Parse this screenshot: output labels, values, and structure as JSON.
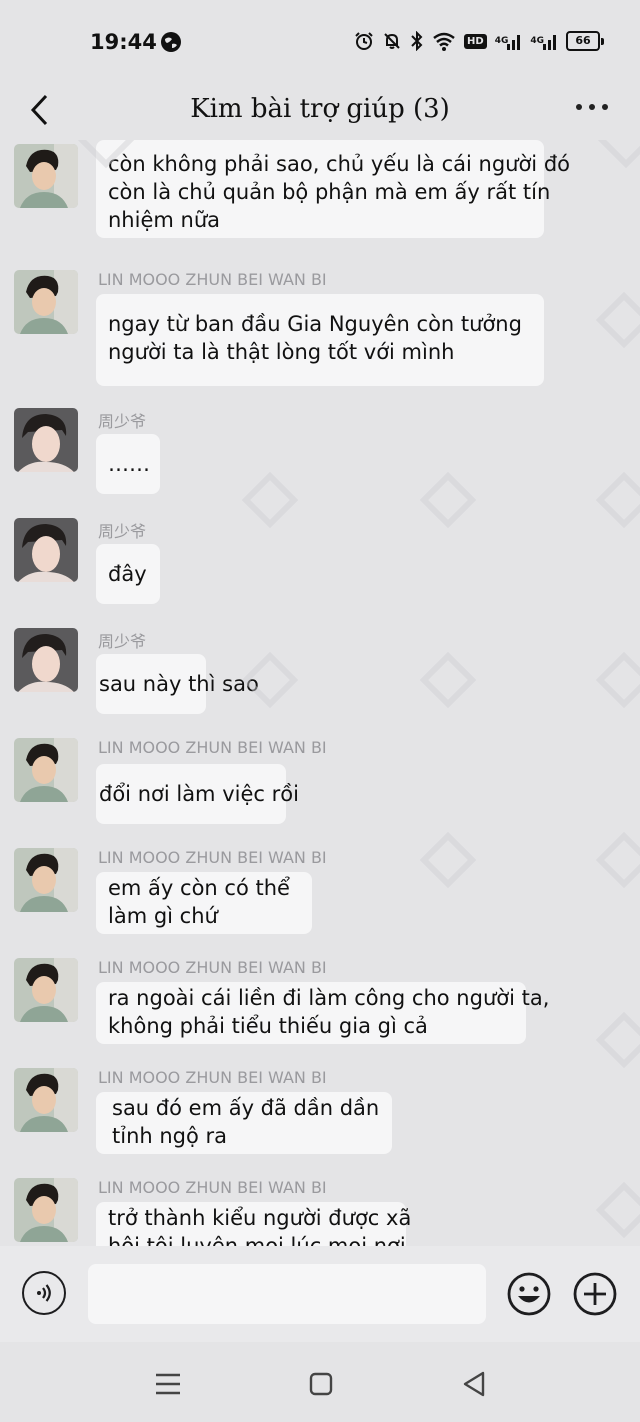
{
  "status_bar": {
    "time": "19:44",
    "network_1": "4G",
    "network_2": "4G",
    "hd_label": "HD",
    "battery": "66",
    "icons": [
      "globe-icon",
      "alarm-icon",
      "mute-icon",
      "bluetooth-icon",
      "wifi-icon",
      "hd-icon",
      "signal-icon",
      "battery-icon"
    ]
  },
  "header": {
    "title": "Kim bài trợ giúp (3)",
    "back_icon": "chevron-left-icon",
    "more_icon": "more-icon"
  },
  "messages": [
    {
      "sender": "",
      "avatar": "avatar-lin",
      "lines": [
        "còn không phải sao, chủ yếu là cái người đó",
        "còn là chủ quản bộ phận mà em ấy rất tín",
        "nhiệm nữa"
      ]
    },
    {
      "sender": "LIN MOOO ZHUN BEI WAN BI",
      "avatar": "avatar-lin",
      "lines": [
        "ngay từ ban đầu Gia Nguyên còn tưởng",
        "người ta là thật lòng tốt với mình"
      ]
    },
    {
      "sender": "周少爷",
      "avatar": "avatar-zhou",
      "lines": [
        "……"
      ]
    },
    {
      "sender": "周少爷",
      "avatar": "avatar-zhou",
      "lines": [
        "đây"
      ]
    },
    {
      "sender": "周少爷",
      "avatar": "avatar-zhou",
      "lines": [
        "sau này thì sao"
      ]
    },
    {
      "sender": "LIN MOOO ZHUN BEI WAN BI",
      "avatar": "avatar-lin",
      "lines": [
        "đổi nơi làm việc rồi"
      ]
    },
    {
      "sender": "LIN MOOO ZHUN BEI WAN BI",
      "avatar": "avatar-lin",
      "lines": [
        "em ấy còn có thể",
        "làm gì chứ"
      ]
    },
    {
      "sender": "LIN MOOO ZHUN BEI WAN BI",
      "avatar": "avatar-lin",
      "lines": [
        "ra ngoài cái liền đi làm công cho người ta,",
        "không phải tiểu thiếu gia gì cả"
      ]
    },
    {
      "sender": "LIN MOOO ZHUN BEI WAN BI",
      "avatar": "avatar-lin",
      "lines": [
        "sau đó em ấy đã dần dần",
        "tỉnh ngộ ra"
      ]
    },
    {
      "sender": "LIN MOOO ZHUN BEI WAN BI",
      "avatar": "avatar-lin",
      "lines": [
        "trở thành kiểu người được xã",
        "hội tôi luyện mọi lúc mọi nơi"
      ]
    }
  ],
  "input_bar": {
    "placeholder": "",
    "voice_icon": "voice-icon",
    "emoji_icon": "emoji-icon",
    "plus_icon": "plus-icon"
  },
  "nav_bar": {
    "icons": [
      "menu-icon",
      "home-icon",
      "back-triangle-icon"
    ]
  },
  "colors": {
    "background": "#e4e4e6",
    "bubble": "#f6f6f7",
    "sender_text": "#9a9a9e",
    "text": "#111111"
  }
}
